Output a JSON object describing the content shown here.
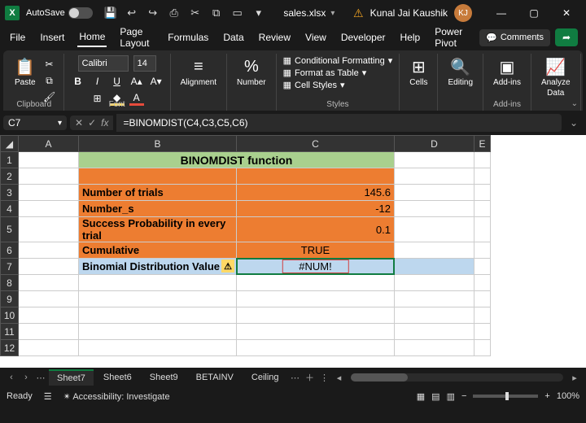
{
  "titlebar": {
    "autosave_label": "AutoSave",
    "autosave_state": "Off",
    "filename": "sales.xlsx",
    "user_name": "Kunal Jai Kaushik",
    "user_initials": "KJ"
  },
  "tabs": {
    "items": [
      "File",
      "Insert",
      "Home",
      "Page Layout",
      "Formulas",
      "Data",
      "Review",
      "View",
      "Developer",
      "Help",
      "Power Pivot"
    ],
    "active": "Home",
    "comments_label": "Comments"
  },
  "ribbon": {
    "clipboard": {
      "label": "Clipboard",
      "paste": "Paste"
    },
    "font": {
      "label": "Font",
      "name": "Calibri",
      "size": "14"
    },
    "alignment": {
      "label": "Alignment",
      "btn": "Alignment"
    },
    "number": {
      "label": "Number",
      "btn": "Number"
    },
    "styles": {
      "label": "Styles",
      "cond_fmt": "Conditional Formatting",
      "fmt_table": "Format as Table",
      "cell_styles": "Cell Styles"
    },
    "cells": {
      "label": "Cells",
      "btn": "Cells"
    },
    "editing": {
      "label": "Editing",
      "btn": "Editing"
    },
    "addins": {
      "label": "Add-ins",
      "btn": "Add-ins"
    },
    "analyze": {
      "btn_l1": "Analyze",
      "btn_l2": "Data"
    }
  },
  "formula_bar": {
    "cell_ref": "C7",
    "formula": "=BINOMDIST(C4,C3,C5,C6)"
  },
  "sheet": {
    "columns": [
      "A",
      "B",
      "C",
      "D",
      "E"
    ],
    "rows": [
      "1",
      "2",
      "3",
      "4",
      "5",
      "6",
      "7",
      "8",
      "9",
      "10",
      "11",
      "12"
    ],
    "title": "BINOMDIST function",
    "b3": "Number of trials",
    "c3": "145.6",
    "b4": "Number_s",
    "c4": "-12",
    "b5": "Success Probability in every trial",
    "c5": "0.1",
    "b6": "Cumulative",
    "c6": "TRUE",
    "b7": "Binomial Distribution Value",
    "c7": "#NUM!"
  },
  "sheet_tabs": {
    "items": [
      "Sheet7",
      "Sheet6",
      "Sheet9",
      "BETAINV",
      "Ceiling"
    ],
    "active": "Sheet7"
  },
  "status": {
    "mode": "Ready",
    "accessibility": "Accessibility: Investigate",
    "zoom": "100%"
  }
}
